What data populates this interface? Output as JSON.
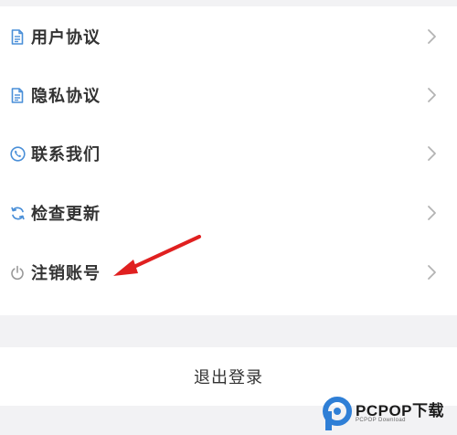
{
  "colors": {
    "icon_blue": "#4a8fd8",
    "icon_gray": "#999999",
    "chevron": "#b3b3b3",
    "text": "#333333",
    "arrow": "#e02020",
    "background": "#f2f2f4",
    "card": "#ffffff"
  },
  "menu": {
    "items": [
      {
        "label": "用户协议",
        "icon": "document-icon"
      },
      {
        "label": "隐私协议",
        "icon": "document-icon"
      },
      {
        "label": "联系我们",
        "icon": "phone-icon"
      },
      {
        "label": "检查更新",
        "icon": "refresh-icon"
      },
      {
        "label": "注销账号",
        "icon": "power-icon"
      }
    ]
  },
  "logout": {
    "label": "退出登录"
  },
  "watermark": {
    "brand": "PCPOP下载",
    "sub": "PCPOP Download"
  }
}
